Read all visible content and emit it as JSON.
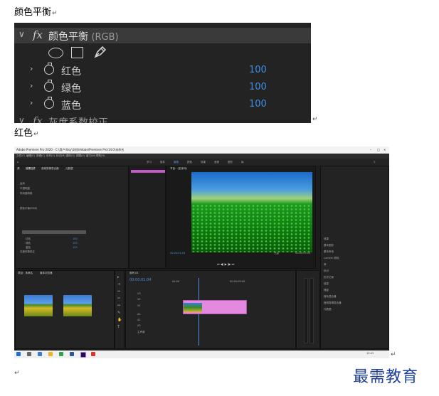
{
  "doc": {
    "heading1": "颜色平衡",
    "heading2": "红色",
    "para_mark": "↵"
  },
  "effect_panel": {
    "fx_label": "fx",
    "effect_name": "颜色平衡",
    "effect_suffix": "(RGB)",
    "params": [
      {
        "label": "红色",
        "value": "100"
      },
      {
        "label": "绿色",
        "value": "100"
      },
      {
        "label": "蓝色",
        "value": "100"
      }
    ],
    "next_effect_name": "灰度系数校正",
    "value_color": "#3d8fe6"
  },
  "premiere": {
    "title": "Adobe Premiere Pro 2020 - C:\\用户\\lilsy\\文档\\Adobe\\Premiere Pro\\14.0\\未命名",
    "menu": [
      "文件(F)",
      "编辑(E)",
      "剪辑(C)",
      "序列(S)",
      "标记(M)",
      "图形(G)",
      "视图(V)",
      "窗口(W)",
      "帮助(H)"
    ],
    "workspaces": [
      "学习",
      "组件",
      "编辑",
      "颜色",
      "效果",
      "音频",
      "图形",
      "库"
    ],
    "left_tabs": [
      "源",
      "效果控件",
      "音频剪辑混合器",
      "元数据"
    ],
    "left_params": [
      "运动",
      "不透明度",
      "时间重映射",
      "颜色平衡(RGB)",
      "红色",
      "绿色",
      "蓝色",
      "灰度系数校正"
    ],
    "left_values": [
      "100",
      "100",
      "100"
    ],
    "program_tab": "节目：(无序列)",
    "timecode_left": "00:00:01:04",
    "timecode_right": "00:00:05:04",
    "fit_label": "完整",
    "project_tabs": [
      "项目：未命名",
      "媒体浏览器"
    ],
    "right_panel_items": [
      "效果",
      "基本图形",
      "基本声音",
      "Lumetri 颜色",
      "库",
      "标记",
      "历史记录",
      "信息",
      "捕捉",
      "音轨混合器",
      "音频剪辑混合器",
      "元数据"
    ],
    "timeline_tab": "序列 01",
    "timeline_timecode": "00:00:01:04",
    "ruler": [
      "00:00",
      "00:00:05:00"
    ],
    "tracks": [
      "V3",
      "V2",
      "V1",
      "A1",
      "A2",
      "A3",
      "主声道"
    ]
  },
  "watermark": "最需教育"
}
